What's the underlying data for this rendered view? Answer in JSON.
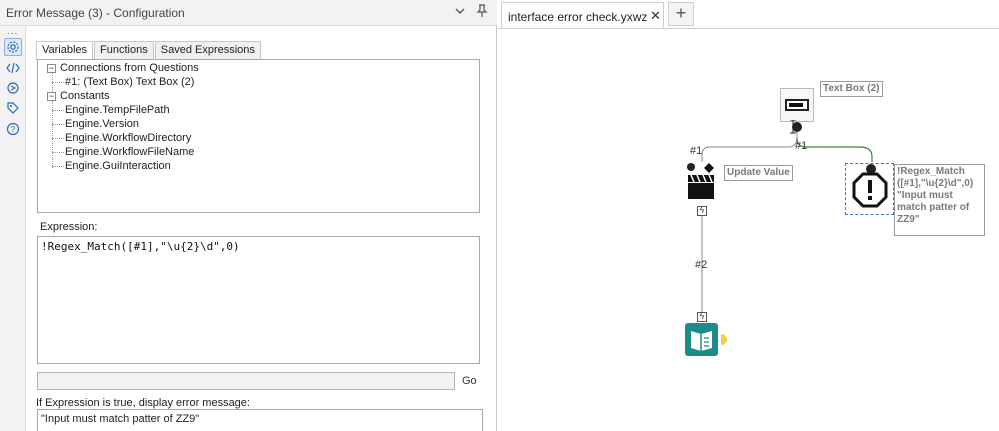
{
  "panel": {
    "title": "Error Message (3) - Configuration",
    "collapse_icon": "chevron-down-icon",
    "pin_icon": "pin-icon",
    "rail": {
      "dots": "...",
      "icons": [
        "gear-icon",
        "code-icon",
        "refresh-icon",
        "tag-icon",
        "help-icon"
      ]
    },
    "tabs": [
      "Variables",
      "Functions",
      "Saved Expressions"
    ],
    "active_tab": "Variables",
    "tree": {
      "group1": "Connections from Questions",
      "group1_items": [
        "#1: (Text Box) Text Box (2)"
      ],
      "group2": "Constants",
      "group2_items": [
        "Engine.TempFilePath",
        "Engine.Version",
        "Engine.WorkflowDirectory",
        "Engine.WorkflowFileName",
        "Engine.GuiInteraction"
      ]
    },
    "expression_label": "Expression:",
    "expression": "!Regex_Match([#1],\"\\u{2}\\d\",0)",
    "go_label": "Go",
    "message_label": "If Expression is true, display error message:",
    "message": "\"Input must match patter of ZZ9\""
  },
  "canvas": {
    "doc_tab": "interface error check.yxwz",
    "close_symbol": "✕",
    "add_symbol": "+",
    "nodes": {
      "textbox": "Text Box (2)",
      "update_value": "Update Value",
      "error_message": "!Regex_Match ([#1],\"\\u{2}\\d\",0) \"Input must match patter of ZZ9\""
    },
    "connections": {
      "c1a": "#1",
      "c1b": "#1",
      "c2": "#2"
    },
    "colors": {
      "accent": "#1a8c8c",
      "connection_green": "#2e8b3e",
      "selection": "#2b7bd4"
    }
  }
}
